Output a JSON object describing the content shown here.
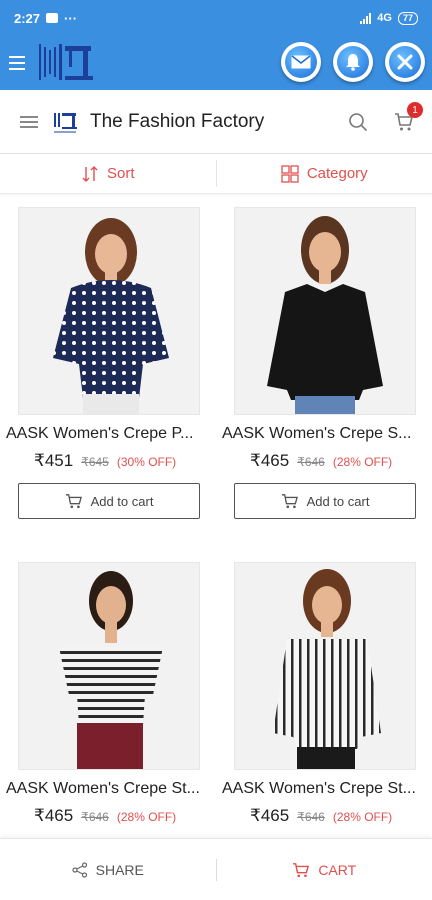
{
  "status_bar": {
    "time": "2:27",
    "network": "4G",
    "battery": "77"
  },
  "colors": {
    "primary": "#3a8fe0",
    "accent": "#e0504f",
    "badge": "#e02b2b"
  },
  "app_bar": {
    "icons": [
      "menu-icon",
      "sewing-machine-logo",
      "mail-icon",
      "bell-icon",
      "close-icon"
    ]
  },
  "header": {
    "brand_name": "The Fashion Factory",
    "cart_count": "1"
  },
  "filter_bar": {
    "sort_label": "Sort",
    "category_label": "Category"
  },
  "products": [
    {
      "title": "AASK Women's Crepe P...",
      "price": "₹451",
      "mrp": "₹645",
      "discount": "(30% OFF)",
      "add_label": "Add to cart"
    },
    {
      "title": "AASK Women's Crepe S...",
      "price": "₹465",
      "mrp": "₹646",
      "discount": "(28% OFF)",
      "add_label": "Add to cart"
    },
    {
      "title": "AASK Women's Crepe St...",
      "price": "₹465",
      "mrp": "₹646",
      "discount": "(28% OFF)",
      "add_label": ""
    },
    {
      "title": "AASK Women's Crepe St...",
      "price": "₹465",
      "mrp": "₹646",
      "discount": "(28% OFF)",
      "add_label": ""
    }
  ],
  "bottom_bar": {
    "share_label": "SHARE",
    "cart_label": "CART"
  }
}
